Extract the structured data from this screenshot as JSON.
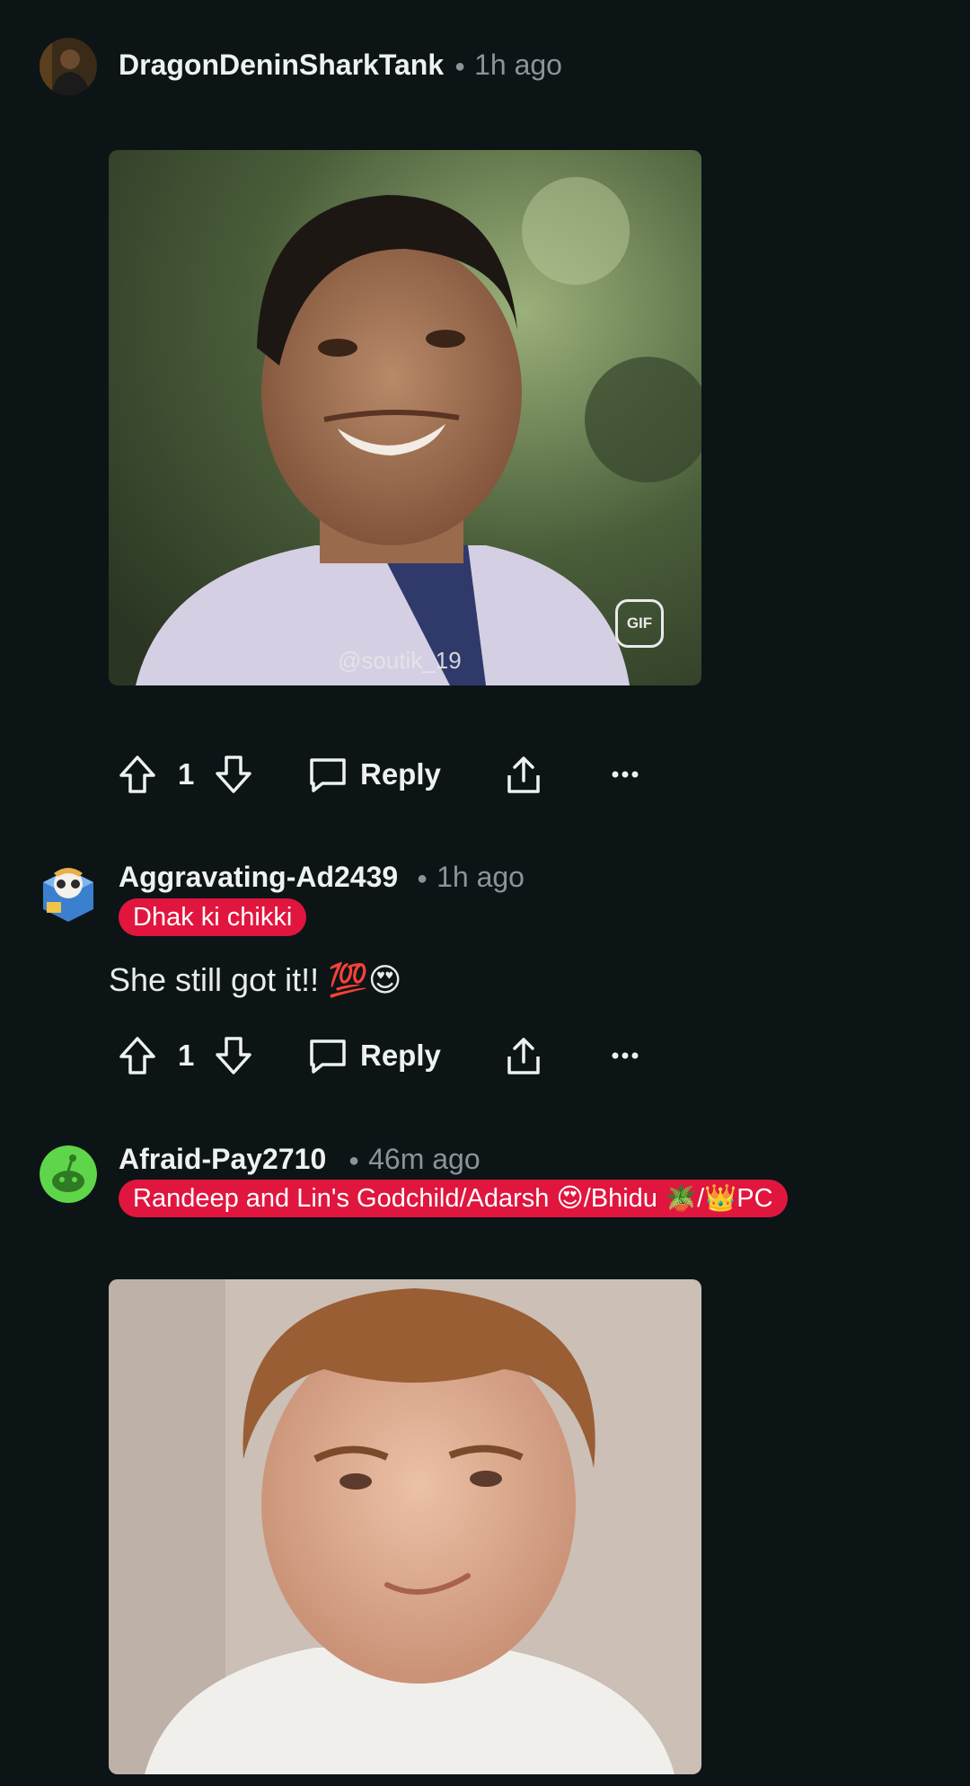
{
  "comments": [
    {
      "username": "DragonDeninSharkTank",
      "time": "1h ago",
      "media": {
        "type": "gif",
        "badge": "GIF",
        "watermark": "@soutik_19"
      },
      "votes": "1",
      "reply_label": "Reply"
    },
    {
      "username": "Aggravating-Ad2439",
      "time": "1h ago",
      "flair": "Dhak ki chikki",
      "text": "She still got it!! 💯😍",
      "votes": "1",
      "reply_label": "Reply"
    },
    {
      "username": "Afraid-Pay2710",
      "time": "46m ago",
      "flair": "Randeep and Lin's Godchild/Adarsh 😍/Bhidu 🪴/👑PC",
      "media": {
        "type": "gif"
      }
    }
  ],
  "colors": {
    "background": "#0c1416",
    "flair": "#e0163f",
    "muted": "#8a9499"
  },
  "icons": [
    "upvote-icon",
    "downvote-icon",
    "comment-icon",
    "share-icon",
    "more-icon",
    "gif-icon"
  ]
}
